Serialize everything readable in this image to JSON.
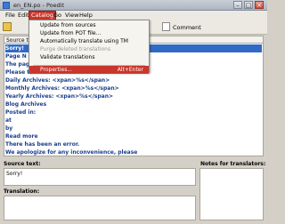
{
  "window": {
    "title": "en_EN.po - Poedit"
  },
  "menubar": {
    "file": "File",
    "edit": "Edit",
    "catalog": "Catalog",
    "go": "Go",
    "view": "View",
    "help": "Help"
  },
  "toolbar": {
    "comment": "Comment"
  },
  "list": {
    "header": "Source text",
    "rows": [
      "Sorry!",
      "Page N",
      "The pag",
      "Please t",
      "Daily Archives: <xpan>%s</span>",
      "Monthly Archives: <xpan>%s</span>",
      "Yearly Archives: <xpan>%s</span>",
      "Blog Archives",
      "Posted in:",
      "at",
      "by",
      "Read more",
      "There has been an error.",
      "We apologize for any inconvenience, please"
    ]
  },
  "catalog_menu": {
    "items": [
      {
        "label": "Update from sources",
        "shortcut": ""
      },
      {
        "label": "Update from POT file...",
        "shortcut": ""
      },
      {
        "label": "Automatically translate using TM",
        "shortcut": ""
      },
      {
        "label": "Purge deleted translations",
        "shortcut": ""
      },
      {
        "label": "Validate translations",
        "shortcut": ""
      },
      {
        "label": "Properties...",
        "shortcut": "Alt+Enter"
      }
    ]
  },
  "editor": {
    "source_label": "Source text:",
    "source_value": "Sorry!",
    "translation_label": "Translation:",
    "notes_label": "Notes for translators:"
  }
}
